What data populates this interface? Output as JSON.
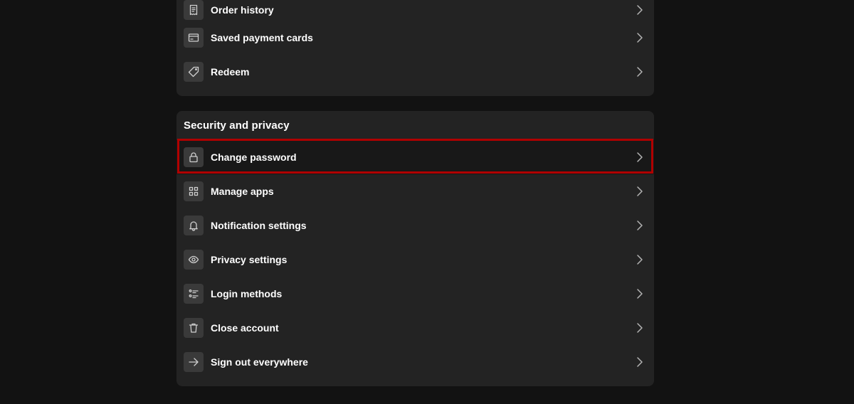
{
  "payment_section": {
    "items": [
      {
        "label": "Order history",
        "icon": "receipt-icon"
      },
      {
        "label": "Saved payment cards",
        "icon": "credit-card-icon"
      },
      {
        "label": "Redeem",
        "icon": "tag-icon"
      }
    ]
  },
  "security_section": {
    "title": "Security and privacy",
    "items": [
      {
        "label": "Change password",
        "icon": "lock-icon",
        "highlighted": true
      },
      {
        "label": "Manage apps",
        "icon": "apps-grid-icon"
      },
      {
        "label": "Notification settings",
        "icon": "bell-icon"
      },
      {
        "label": "Privacy settings",
        "icon": "eye-icon"
      },
      {
        "label": "Login methods",
        "icon": "list-icon"
      },
      {
        "label": "Close account",
        "icon": "trash-icon"
      },
      {
        "label": "Sign out everywhere",
        "icon": "arrow-right-icon"
      }
    ]
  },
  "colors": {
    "page_background": "#121212",
    "card_background": "#232323",
    "highlight_border": "#b00000"
  }
}
